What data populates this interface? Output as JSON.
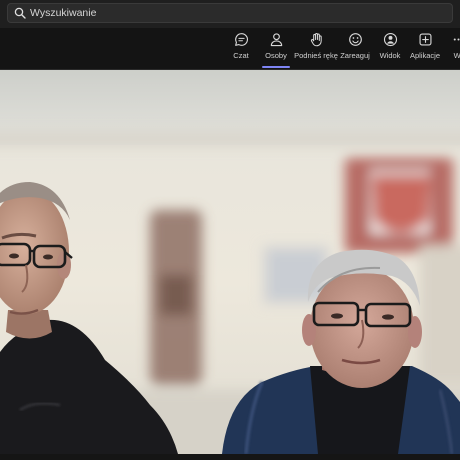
{
  "search": {
    "placeholder": "Wyszukiwanie"
  },
  "toolbar": {
    "items": [
      {
        "label": "Czat",
        "icon": "chat-icon"
      },
      {
        "label": "Osoby",
        "icon": "people-icon",
        "active": true
      },
      {
        "label": "Podnieś rękę",
        "icon": "raise-hand-icon"
      },
      {
        "label": "Zareaguj",
        "icon": "react-icon"
      },
      {
        "label": "Widok",
        "icon": "view-icon"
      },
      {
        "label": "Aplikacje",
        "icon": "apps-icon"
      },
      {
        "label": "Wi",
        "icon": "more-icon"
      }
    ]
  },
  "colors": {
    "accent": "#7f85f5",
    "titlebar": "#1f1f1f",
    "toolbar": "#141414"
  }
}
